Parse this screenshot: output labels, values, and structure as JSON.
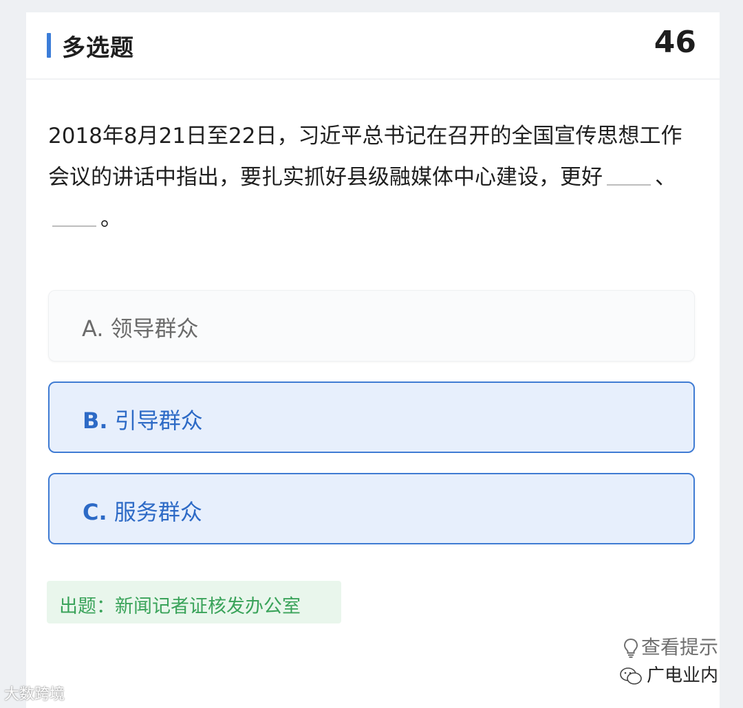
{
  "header": {
    "type_label": "多选题",
    "question_number": "46"
  },
  "question": {
    "text_part1": "2018年8月21日至22日，习近平总书记在召开的全国宣传思想工作会议的讲话中指出，要扎实抓好县级融媒体中心建设，更好",
    "separator": "、",
    "end": "。"
  },
  "options": [
    {
      "letter": "A.",
      "text": "领导群众",
      "selected": false
    },
    {
      "letter": "B.",
      "text": "引导群众",
      "selected": true
    },
    {
      "letter": "C.",
      "text": "服务群众",
      "selected": true
    }
  ],
  "source": {
    "text": "出题：新闻记者证核发办公室"
  },
  "hint": {
    "label": "查看提示",
    "icon": "lightbulb-icon"
  },
  "watermarks": {
    "left": "大数跨境",
    "right": "广电业内"
  },
  "colors": {
    "accent": "#3b7dd8",
    "selected_bg": "#e7effc",
    "source_green": "#3aa35a"
  }
}
